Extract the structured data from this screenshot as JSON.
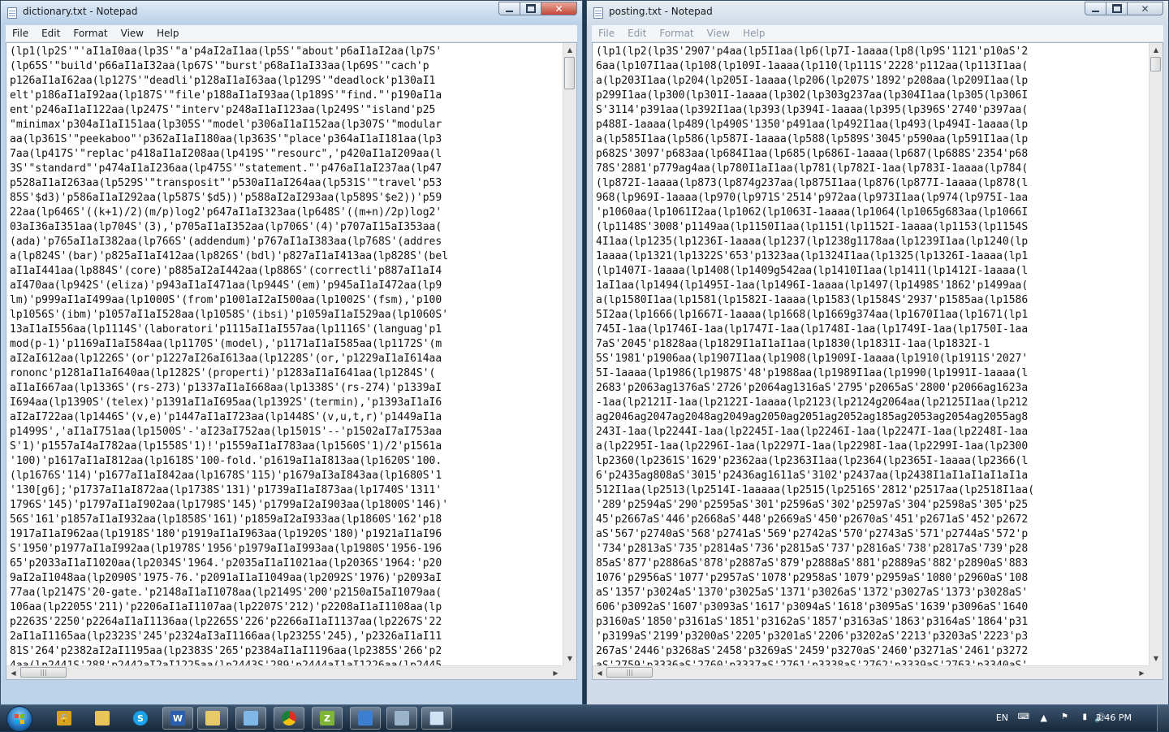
{
  "left_window": {
    "title": "dictionary.txt - Notepad",
    "menu": [
      "File",
      "Edit",
      "Format",
      "View",
      "Help"
    ],
    "lines": [
      "(lp1(lp2S'\"'aI1aI0aa(lp3S'\"a'p4aI2aI1aa(lp5S'\"about'p6aI1aI2aa(lp7S'",
      "(lp65S'\"build'p66aI1aI32aa(lp67S'\"burst'p68aI1aI33aa(lp69S'\"cach'p",
      "p126aI1aI62aa(lp127S'\"deadli'p128aI1aI63aa(lp129S'\"deadlock'p130aI1",
      "elt'p186aI1aI92aa(lp187S'\"file'p188aI1aI93aa(lp189S'\"find.\"'p190aI1a",
      "ent'p246aI1aI122aa(lp247S'\"interv'p248aI1aI123aa(lp249S'\"island'p25",
      "\"minimax'p304aI1aI151aa(lp305S'\"model'p306aI1aI152aa(lp307S'\"modular",
      "aa(lp361S'\"peekaboo\"'p362aI1aI180aa(lp363S'\"place'p364aI1aI181aa(lp3",
      "7aa(lp417S'\"replac'p418aI1aI208aa(lp419S'\"resourc\",'p420aI1aI209aa(l",
      "3S'\"standard\"'p474aI1aI236aa(lp475S'\"statement.\"'p476aI1aI237aa(lp47",
      "p528aI1aI263aa(lp529S'\"transposit\"'p530aI1aI264aa(lp531S'\"travel'p53",
      "85S'$d3)'p586aI1aI292aa(lp587S'$d5))'p588aI2aI293aa(lp589S'$e2))'p59",
      "22aa(lp646S'((k+1)/2)(m/p)log2'p647aI1aI323aa(lp648S'((m+n)/2p)log2'",
      "03aI36aI351aa(lp704S'(3),'p705aI1aI352aa(lp706S'(4)'p707aI15aI353aa(",
      "(ada)'p765aI1aI382aa(lp766S'(addendum)'p767aI1aI383aa(lp768S'(addres",
      "a(lp824S'(bar)'p825aI1aI412aa(lp826S'(bdl)'p827aI1aI413aa(lp828S'(bel",
      "aI1aI441aa(lp884S'(core)'p885aI2aI442aa(lp886S'(correctli'p887aI1aI4",
      "aI470aa(lp942S'(eliza)'p943aI1aI471aa(lp944S'(em)'p945aI1aI472aa(lp9",
      "lm)'p999aI1aI499aa(lp1000S'(from'p1001aI2aI500aa(lp1002S'(fsm),'p100",
      "lp1056S'(ibm)'p1057aI1aI528aa(lp1058S'(ibsi)'p1059aI1aI529aa(lp1060S'",
      "13aI1aI556aa(lp1114S'(laboratori'p1115aI1aI557aa(lp1116S'(languag'p1",
      "mod(p-1)'p1169aI1aI584aa(lp1170S'(model),'p1171aI1aI585aa(lp1172S'(m",
      "aI2aI612aa(lp1226S'(or'p1227aI26aI613aa(lp1228S'(or,'p1229aI1aI614aa",
      "rononc'p1281aI1aI640aa(lp1282S'(properti)'p1283aI1aI641aa(lp1284S'(",
      "aI1aI667aa(lp1336S'(rs-273)'p1337aI1aI668aa(lp1338S'(rs-274)'p1339aI",
      "I694aa(lp1390S'(telex)'p1391aI1aI695aa(lp1392S'(termin),'p1393aI1aI6",
      "aI2aI722aa(lp1446S'(v,e)'p1447aI1aI723aa(lp1448S'(v,u,t,r)'p1449aI1a",
      "p1499S','aI1aI751aa(lp1500S'-'aI23aI752aa(lp1501S'--'p1502aI7aI753aa",
      "S'1)'p1557aI4aI782aa(lp1558S'1)!'p1559aI1aI783aa(lp1560S'1)/2'p1561a",
      "'100)'p1617aI1aI812aa(lp1618S'100-fold.'p1619aI1aI813aa(lp1620S'100.",
      "(lp1676S'114)'p1677aI1aI842aa(lp1678S'115)'p1679aI3aI843aa(lp1680S'1",
      "'130[g6];'p1737aI1aI872aa(lp1738S'131)'p1739aI1aI873aa(lp1740S'1311'",
      "1796S'145)'p1797aI1aI902aa(lp1798S'145)'p1799aI2aI903aa(lp1800S'146)'",
      "56S'161'p1857aI1aI932aa(lp1858S'161)'p1859aI2aI933aa(lp1860S'162'p18",
      "1917aI1aI962aa(lp1918S'180'p1919aI1aI963aa(lp1920S'180)'p1921aI1aI96",
      "S'1950'p1977aI1aI992aa(lp1978S'1956'p1979aI1aI993aa(lp1980S'1956-196",
      "65'p2033aI1aI1020aa(lp2034S'1964.'p2035aI1aI1021aa(lp2036S'1964:'p20",
      "9aI2aI1048aa(lp2090S'1975-76.'p2091aI1aI1049aa(lp2092S'1976)'p2093aI",
      "77aa(lp2147S'20-gate.'p2148aI1aI1078aa(lp2149S'200'p2150aI5aI1079aa(",
      "106aa(lp2205S'211)'p2206aI1aI1107aa(lp2207S'212)'p2208aI1aI1108aa(lp",
      "p2263S'2250'p2264aI1aI1136aa(lp2265S'226'p2266aI1aI1137aa(lp2267S'22",
      "2aI1aI1165aa(lp2323S'245'p2324aI3aI1166aa(lp2325S'245),'p2326aI1aI11",
      "81S'264'p2382aI2aI1195aa(lp2383S'265'p2384aI1aI1196aa(lp2385S'266'p2",
      "4aa(lp2441S'288'p2442aI2aI1225aa(lp2443S'289'p2444aI1aI1226aa(lp2445"
    ]
  },
  "right_window": {
    "title": "posting.txt - Notepad",
    "menu": [
      "File",
      "Edit",
      "Format",
      "View",
      "Help"
    ],
    "lines": [
      "(lp1(lp2(lp3S'2907'p4aa(lp5I1aa(lp6(lp7I-1aaaa(lp8(lp9S'1121'p10aS'2",
      "6aa(lp107I1aa(lp108(lp109I-1aaaa(lp110(lp111S'2228'p112aa(lp113I1aa(",
      "a(lp203I1aa(lp204(lp205I-1aaaa(lp206(lp207S'1892'p208aa(lp209I1aa(lp",
      "p299I1aa(lp300(lp301I-1aaaa(lp302(lp303g237aa(lp304I1aa(lp305(lp306I",
      "S'3114'p391aa(lp392I1aa(lp393(lp394I-1aaaa(lp395(lp396S'2740'p397aa(",
      "p488I-1aaaa(lp489(lp490S'1350'p491aa(lp492I1aa(lp493(lp494I-1aaaa(lp",
      "a(lp585I1aa(lp586(lp587I-1aaaa(lp588(lp589S'3045'p590aa(lp591I1aa(lp",
      "p682S'3097'p683aa(lp684I1aa(lp685(lp686I-1aaaa(lp687(lp688S'2354'p68",
      "78S'2881'p779ag4aa(lp780I1aI1aa(lp781(lp782I-1aa(lp783I-1aaaa(lp784(",
      "(lp872I-1aaaa(lp873(lp874g237aa(lp875I1aa(lp876(lp877I-1aaaa(lp878(l",
      "968(lp969I-1aaaa(lp970(lp971S'2514'p972aa(lp973I1aa(lp974(lp975I-1aa",
      "'p1060aa(lp1061I2aa(lp1062(lp1063I-1aaaa(lp1064(lp1065g683aa(lp1066I",
      "(lp1148S'3008'p1149aa(lp1150I1aa(lp1151(lp1152I-1aaaa(lp1153(lp1154S",
      "4I1aa(lp1235(lp1236I-1aaaa(lp1237(lp1238g1178aa(lp1239I1aa(lp1240(lp",
      "1aaaa(lp1321(lp1322S'653'p1323aa(lp1324I1aa(lp1325(lp1326I-1aaaa(lp1",
      "(lp1407I-1aaaa(lp1408(lp1409g542aa(lp1410I1aa(lp1411(lp1412I-1aaaa(l",
      "1aI1aa(lp1494(lp1495I-1aa(lp1496I-1aaaa(lp1497(lp1498S'1862'p1499aa(",
      "a(lp1580I1aa(lp1581(lp1582I-1aaaa(lp1583(lp1584S'2937'p1585aa(lp1586",
      "5I2aa(lp1666(lp1667I-1aaaa(lp1668(lp1669g374aa(lp1670I1aa(lp1671(lp1",
      "745I-1aa(lp1746I-1aa(lp1747I-1aa(lp1748I-1aa(lp1749I-1aa(lp1750I-1aa",
      "7aS'2045'p1828aa(lp1829I1aI1aI1aa(lp1830(lp1831I-1aa(lp1832I-1",
      "5S'1981'p1906aa(lp1907I1aa(lp1908(lp1909I-1aaaa(lp1910(lp1911S'2027'",
      "5I-1aaaa(lp1986(lp1987S'48'p1988aa(lp1989I1aa(lp1990(lp1991I-1aaaa(l",
      "2683'p2063ag1376aS'2726'p2064ag1316aS'2795'p2065aS'2800'p2066ag1623a",
      "-1aa(lp2121I-1aa(lp2122I-1aaaa(lp2123(lp2124g2064aa(lp2125I1aa(lp212",
      "ag2046ag2047ag2048ag2049ag2050ag2051ag2052ag185ag2053ag2054ag2055ag8",
      "243I-1aa(lp2244I-1aa(lp2245I-1aa(lp2246I-1aa(lp2247I-1aa(lp2248I-1aa",
      "a(lp2295I-1aa(lp2296I-1aa(lp2297I-1aa(lp2298I-1aa(lp2299I-1aa(lp2300",
      "lp2360(lp2361S'1629'p2362aa(lp2363I1aa(lp2364(lp2365I-1aaaa(lp2366(l",
      "6'p2435ag808aS'3015'p2436ag1611aS'3102'p2437aa(lp2438I1aI1aI1aI1aI1a",
      "512I1aa(lp2513(lp2514I-1aaaaa(lp2515(lp2516S'2812'p2517aa(lp2518I1aa(",
      "'289'p2594aS'290'p2595aS'301'p2596aS'302'p2597aS'304'p2598aS'305'p25",
      "45'p2667aS'446'p2668aS'448'p2669aS'450'p2670aS'451'p2671aS'452'p2672",
      "aS'567'p2740aS'568'p2741aS'569'p2742aS'570'p2743aS'571'p2744aS'572'p",
      "'734'p2813aS'735'p2814aS'736'p2815aS'737'p2816aS'738'p2817aS'739'p28",
      "85aS'877'p2886aS'878'p2887aS'879'p2888aS'881'p2889aS'882'p2890aS'883",
      "1076'p2956aS'1077'p2957aS'1078'p2958aS'1079'p2959aS'1080'p2960aS'108",
      "aS'1357'p3024aS'1370'p3025aS'1371'p3026aS'1372'p3027aS'1373'p3028aS'",
      "606'p3092aS'1607'p3093aS'1617'p3094aS'1618'p3095aS'1639'p3096aS'1640",
      "p3160aS'1850'p3161aS'1851'p3162aS'1857'p3163aS'1863'p3164aS'1864'p31",
      "'p3199aS'2199'p3200aS'2205'p3201aS'2206'p3202aS'2213'p3203aS'2223'p3",
      "267aS'2446'p3268aS'2458'p3269aS'2459'p3270aS'2460'p3271aS'2461'p3272",
      "aS'2759'p3336aS'2760'p3337aS'2761'p3338aS'2762'p3339aS'2763'p3340aS'"
    ]
  },
  "taskbar": {
    "pinned": [
      "lock-app",
      "folders-app",
      "skype",
      "word",
      "explorer",
      "messenger",
      "chrome",
      "app-green",
      "app-blue",
      "control-panel",
      "notepad"
    ],
    "tray": {
      "language": "EN",
      "clock": "3:46 PM"
    }
  }
}
